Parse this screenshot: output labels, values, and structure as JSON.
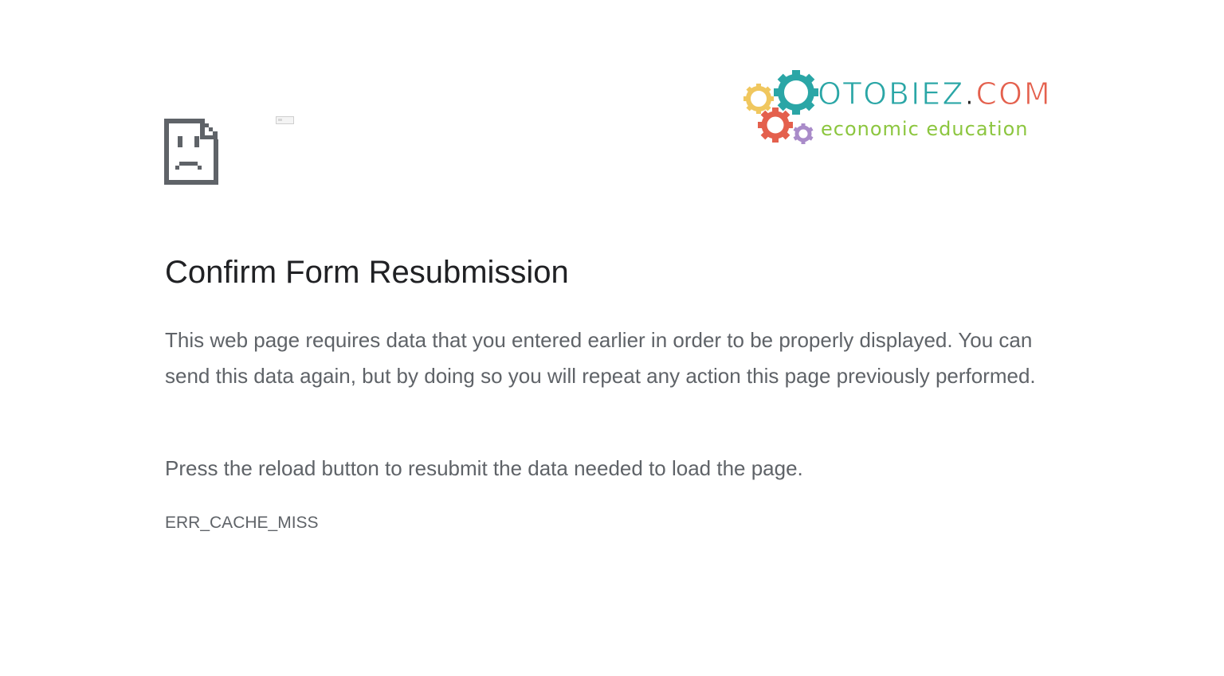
{
  "error_page": {
    "icon": "sad-document-icon",
    "title": "Confirm Form Resubmission",
    "description": "This web page requires data that you entered earlier in order to be properly displayed. You can send this data again, but by doing so you will repeat any action this page previously performed.",
    "reload_hint": "Press the reload button to resubmit the data needed to load the page.",
    "error_code": "ERR_CACHE_MISS"
  },
  "watermark": {
    "brand_main": "OTOBIEZ",
    "brand_dot": ".",
    "brand_tld": "COM",
    "tagline": "economic education",
    "colors": {
      "teal": "#2aa6a6",
      "coral": "#e4604d",
      "yellow": "#f0c75e",
      "purple": "#a98bc9",
      "green": "#8cc63f"
    }
  },
  "colors": {
    "title": "#202124",
    "body_text": "#5f6368",
    "icon": "#5f6368"
  }
}
